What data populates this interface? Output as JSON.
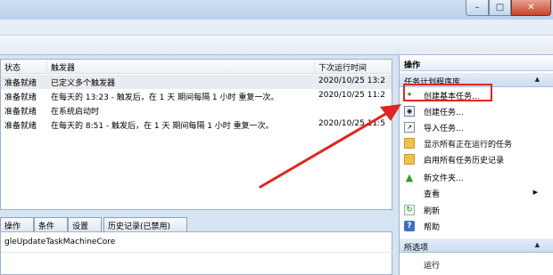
{
  "task_list": {
    "columns": [
      "状态",
      "触发器",
      "下次运行时间"
    ],
    "rows": [
      {
        "status": "准备就绪",
        "trigger": "已定义多个触发器",
        "next_run": "2020/10/25 13:2"
      },
      {
        "status": "准备就绪",
        "trigger": "在每天的 13:23 - 触发后，在 1 天 期间每隔 1 小时 重复一次。",
        "next_run": "2020/10/25 11:2"
      },
      {
        "status": "准备就绪",
        "trigger": "在系统启动时",
        "next_run": ""
      },
      {
        "status": "准备就绪",
        "trigger": "在每天的 8:51 - 触发后，在 1 天 期间每隔 1 小时 重复一次。",
        "next_run": "2020/10/25 11:5"
      }
    ]
  },
  "detail_tabs": [
    "操作",
    "条件",
    "设置",
    "历史记录(已禁用)"
  ],
  "detail_text": "gleUpdateTaskMachineCore",
  "actions": {
    "header": "操作",
    "section1": "任务计划程序库",
    "items": [
      {
        "label": "创建基本任务...",
        "icon": "wizard-icon"
      },
      {
        "label": "创建任务...",
        "icon": "task-icon"
      },
      {
        "label": "导入任务...",
        "icon": "import-icon"
      },
      {
        "label": "显示所有正在运行的任务",
        "icon": "folder-icon"
      },
      {
        "label": "启用所有任务历史记录",
        "icon": "folder-history-icon"
      },
      {
        "label": "新文件夹...",
        "icon": "new-folder-icon"
      },
      {
        "label": "查看",
        "icon": ""
      },
      {
        "label": "刷新",
        "icon": "refresh-icon"
      },
      {
        "label": "帮助",
        "icon": "help-icon"
      }
    ],
    "section2": "所选项",
    "section2_items": [
      {
        "label": "运行",
        "icon": ""
      }
    ]
  },
  "colors": {
    "highlight": "#e0261e",
    "arrow": "#e0261e",
    "selected_row": "#e8ebef"
  }
}
